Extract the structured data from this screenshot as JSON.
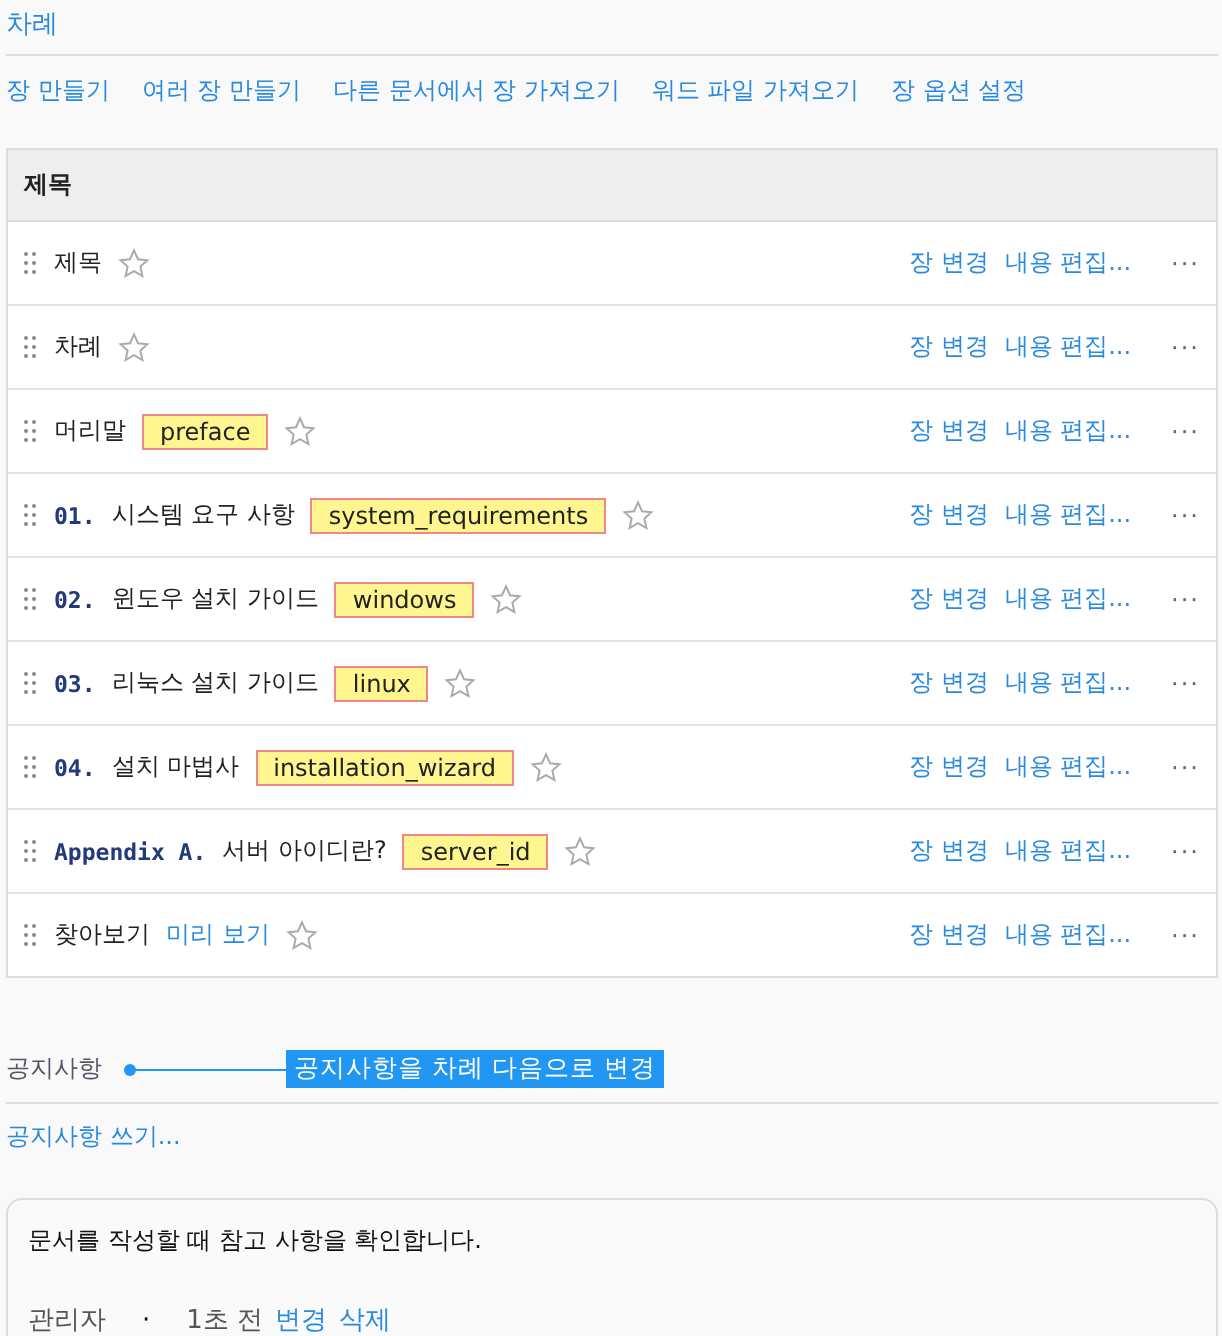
{
  "section_title": "차례",
  "toolbar": [
    "장 만들기",
    "여러 장 만들기",
    "다른 문서에서 장 가져오기",
    "워드 파일 가져오기",
    "장 옵션 설정"
  ],
  "table": {
    "header": "제목",
    "rows": [
      {
        "title": "제목",
        "starred": false,
        "actions": [
          "장 변경",
          "내용 편집..."
        ],
        "more": "···"
      },
      {
        "title": "차례",
        "starred": false,
        "actions": [
          "장 변경",
          "내용 편집..."
        ],
        "more": "···"
      },
      {
        "title": "머리말",
        "tag": "preface",
        "starred": false,
        "actions": [
          "장 변경",
          "내용 편집..."
        ],
        "more": "···"
      },
      {
        "number": "01.",
        "title": "시스템 요구 사항",
        "tag": "system_requirements",
        "starred": false,
        "actions": [
          "장 변경",
          "내용 편집..."
        ],
        "more": "···"
      },
      {
        "number": "02.",
        "title": "윈도우 설치 가이드",
        "tag": "windows",
        "starred": false,
        "actions": [
          "장 변경",
          "내용 편집..."
        ],
        "more": "···"
      },
      {
        "number": "03.",
        "title": "리눅스 설치 가이드",
        "tag": "linux",
        "starred": false,
        "actions": [
          "장 변경",
          "내용 편집..."
        ],
        "more": "···"
      },
      {
        "number": "04.",
        "title": "설치 마법사",
        "tag": "installation_wizard",
        "starred": false,
        "actions": [
          "장 변경",
          "내용 편집..."
        ],
        "more": "···"
      },
      {
        "number": "Appendix A.",
        "title": "서버 아이디란?",
        "tag": "server_id",
        "starred": false,
        "actions": [
          "장 변경",
          "내용 편집..."
        ],
        "more": "···"
      },
      {
        "title": "찾아보기",
        "link": "미리 보기",
        "starred": false,
        "actions": [
          "장 변경",
          "내용 편집..."
        ],
        "more": "···"
      }
    ]
  },
  "notice": {
    "title": "공지사항",
    "tooltip": "공지사항을 차례 다음으로 변경",
    "write_link": "공지사항 쓰기...",
    "card": {
      "text": "문서를 작성할 때 참고 사항을 확인합니다.",
      "author": "관리자",
      "separator": "·",
      "time": "1초 전",
      "actions": [
        "변경",
        "삭제"
      ]
    }
  }
}
